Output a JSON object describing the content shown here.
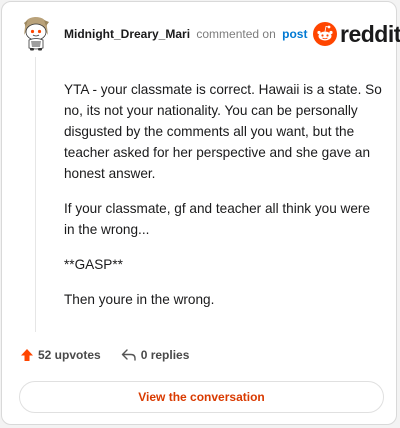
{
  "comment": {
    "username": "Midnight_Dreary_Mari",
    "commented_text": "commented on",
    "post_link": "post",
    "paragraphs": [
      "YTA - your classmate is correct. Hawaii is a state. So no, its not your nationality. You can be personally disgusted by the comments all you want, but the teacher asked for her perspective and she gave an honest answer.",
      "If your classmate, gf and teacher all think you were in the wrong...",
      "**GASP**",
      "Then youre in the wrong."
    ]
  },
  "brand": {
    "wordmark": "reddit",
    "color": "#ff4500"
  },
  "actions": {
    "upvotes": "52 upvotes",
    "replies": "0 replies"
  },
  "cta": {
    "label": "View the conversation"
  },
  "colors": {
    "accent": "#d93a00",
    "link": "#0079d3",
    "upvote": "#ff4500"
  }
}
